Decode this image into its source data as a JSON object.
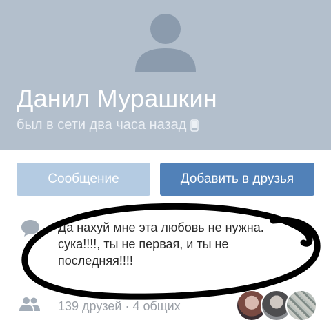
{
  "profile": {
    "name": "Данил Мурашкин",
    "status": "был в сети два часа назад",
    "status_icon": "phone-icon"
  },
  "actions": {
    "message_label": "Сообщение",
    "add_friend_label": "Добавить в друзья"
  },
  "user_status": {
    "text": "Да нахуй мне эта любовь не нужна. сука!!!!, ты не первая, и ты не последняя!!!!",
    "icon": "speech-bubble-icon"
  },
  "friends": {
    "text": "139 друзей · 4 общих",
    "icon": "friends-icon",
    "mutual_avatars": 3
  },
  "colors": {
    "header_bg": "#b3bfcc",
    "primary_button": "#5181b8",
    "secondary_button": "#b4cbe2",
    "annotation_ink": "#000000"
  }
}
